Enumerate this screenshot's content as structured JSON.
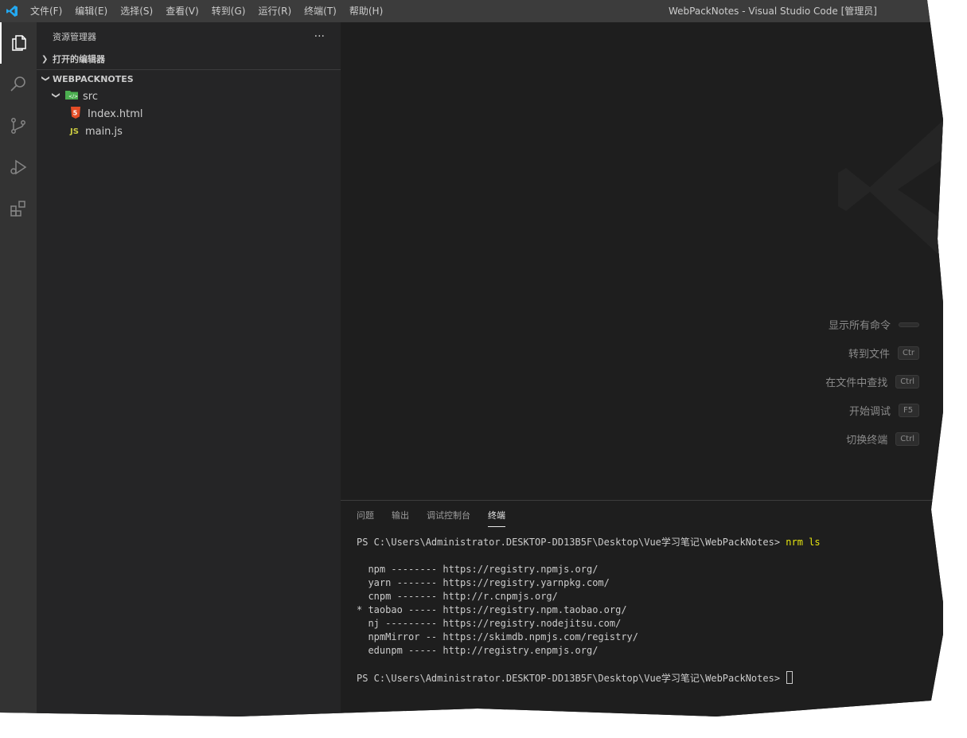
{
  "titlebar": {
    "menu": [
      "文件(F)",
      "编辑(E)",
      "选择(S)",
      "查看(V)",
      "转到(G)",
      "运行(R)",
      "终端(T)",
      "帮助(H)"
    ],
    "window_title": "WebPackNotes - Visual Studio Code [管理员]"
  },
  "activity_bar": [
    "files-icon",
    "search-icon",
    "source-control-icon",
    "run-debug-icon",
    "extensions-icon"
  ],
  "sidebar": {
    "title": "资源管理器",
    "more": "···",
    "open_editors": "打开的编辑器",
    "project": "WEBPACKNOTES",
    "tree": [
      {
        "name": "src",
        "type": "folder"
      },
      {
        "name": "Index.html",
        "type": "html"
      },
      {
        "name": "main.js",
        "type": "js"
      }
    ]
  },
  "welcome": {
    "shortcuts": [
      {
        "label": "显示所有命令",
        "key": ""
      },
      {
        "label": "转到文件",
        "key": "Ctr"
      },
      {
        "label": "在文件中查找",
        "key": "Ctrl"
      },
      {
        "label": "开始调试",
        "key": "F5"
      },
      {
        "label": "切换终端",
        "key": "Ctrl"
      }
    ]
  },
  "panel": {
    "tabs": [
      "问题",
      "输出",
      "调试控制台",
      "终端"
    ],
    "active_tab": "终端",
    "terminal": {
      "prompt": "PS C:\\Users\\Administrator.DESKTOP-DD13B5F\\Desktop\\Vue学习笔记\\WebPackNotes> ",
      "command": "nrm ls",
      "lines": [
        "  npm -------- https://registry.npmjs.org/",
        "  yarn ------- https://registry.yarnpkg.com/",
        "  cnpm ------- http://r.cnpmjs.org/",
        "* taobao ----- https://registry.npm.taobao.org/",
        "  nj --------- https://registry.nodejitsu.com/",
        "  npmMirror -- https://skimdb.npmjs.com/registry/",
        "  edunpm ----- http://registry.enpmjs.org/"
      ],
      "final_prompt": "PS C:\\Users\\Administrator.DESKTOP-DD13B5F\\Desktop\\Vue学习笔记\\WebPackNotes> "
    }
  },
  "colors": {
    "accent": "#0078d4",
    "html_icon": "#e44d26",
    "js_icon": "#cbcb41",
    "folder_icon": "#4caf50",
    "command": "#e5e510"
  }
}
